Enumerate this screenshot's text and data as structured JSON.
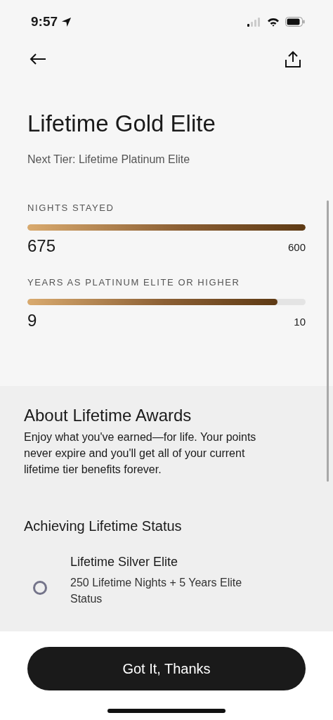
{
  "status_bar": {
    "time": "9:57"
  },
  "title": "Lifetime Gold Elite",
  "next_tier": "Next Tier: Lifetime Platinum Elite",
  "progress": [
    {
      "label": "NIGHTS STAYED",
      "level": 1,
      "value": "675",
      "target": "600"
    },
    {
      "label": "YEARS AS PLATINUM ELITE OR HIGHER",
      "level": 0.9,
      "value": "9",
      "target": "10"
    }
  ],
  "about": {
    "heading": "About Lifetime Awards",
    "text": "Enjoy what you've earned—for life. Your points never expire and you'll get all of your current lifetime tier benefits forever."
  },
  "achieving": {
    "heading": "Achieving Lifetime Status",
    "tiers": [
      {
        "name": "Lifetime Silver Elite",
        "requirement": "250 Lifetime Nights + 5 Years Elite Status",
        "achieved": false
      }
    ]
  },
  "button": "Got It, Thanks"
}
